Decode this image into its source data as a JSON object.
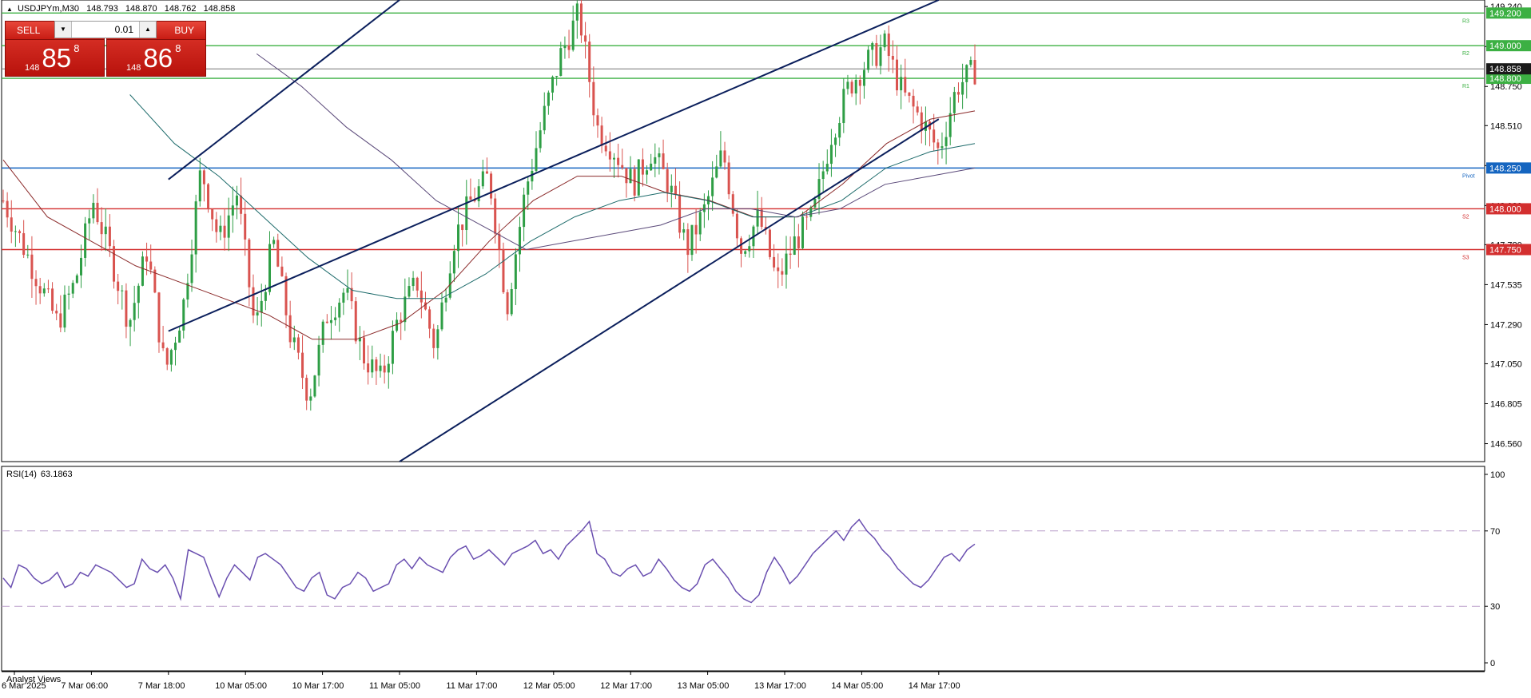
{
  "header": {
    "symbol": "USDJPYm,M30",
    "open": "148.793",
    "high": "148.870",
    "low": "148.762",
    "close": "148.858"
  },
  "trade_panel": {
    "sell_label": "SELL",
    "buy_label": "BUY",
    "volume": "0.01",
    "sell_price": {
      "big": "148",
      "mid": "85",
      "sup": "8"
    },
    "buy_price": {
      "big": "148",
      "mid": "86",
      "sup": "8"
    },
    "colors": {
      "button": "#cc1f16"
    }
  },
  "rsi_label": {
    "name": "RSI(14)",
    "value": "63.1863"
  },
  "footer_text": "Analyst Views",
  "chart_data": [
    {
      "type": "candlestick",
      "title": "USDJPYm,M30",
      "ylim": [
        146.45,
        149.28
      ],
      "y_ticks": [
        "149.240",
        "148.995",
        "148.750",
        "148.510",
        "148.265",
        "148.020",
        "147.780",
        "147.535",
        "147.290",
        "147.050",
        "146.805",
        "146.560"
      ],
      "x_ticks": [
        "6 Mar 2025",
        "7 Mar 06:00",
        "7 Mar 18:00",
        "10 Mar 05:00",
        "10 Mar 17:00",
        "11 Mar 05:00",
        "11 Mar 17:00",
        "12 Mar 05:00",
        "12 Mar 17:00",
        "13 Mar 05:00",
        "13 Mar 17:00",
        "14 Mar 05:00",
        "14 Mar 17:00"
      ],
      "current_price": "148.858",
      "pivot_levels": [
        {
          "name": "R3",
          "value": "149.200",
          "color": "#3cb043"
        },
        {
          "name": "R2",
          "value": "149.000",
          "color": "#3cb043"
        },
        {
          "name": "R1",
          "value": "148.800",
          "color": "#3cb043"
        },
        {
          "name": "Pivot",
          "value": "148.250",
          "color": "#1565c0"
        },
        {
          "name": "S2",
          "value": "148.000",
          "color": "#d32f2f"
        },
        {
          "name": "S3",
          "value": "147.750",
          "color": "#d32f2f"
        }
      ],
      "series": [
        {
          "name": "USDJPYm",
          "key_closes": [
            148.05,
            147.8,
            147.55,
            147.3,
            147.55,
            148.05,
            147.7,
            147.3,
            147.75,
            147.0,
            147.4,
            148.25,
            147.8,
            148.1,
            147.25,
            147.8,
            147.2,
            146.85,
            147.35,
            147.5,
            147.1,
            146.95,
            147.35,
            147.55,
            147.15,
            147.8,
            148.05,
            148.2,
            147.4,
            148.1,
            148.55,
            148.95,
            149.2,
            148.5,
            148.35,
            148.15,
            148.35,
            148.15,
            147.75,
            148.0,
            148.35,
            147.75,
            147.95,
            147.55,
            147.8,
            147.95,
            148.45,
            148.75,
            148.9,
            149.0,
            148.7,
            148.55,
            148.35,
            148.75,
            148.85
          ]
        }
      ],
      "moving_averages": [
        {
          "color": "#8b2a2a",
          "points": [
            148.3,
            147.95,
            147.8,
            147.65,
            147.55,
            147.45,
            147.35,
            147.2,
            147.2,
            147.3,
            147.5,
            147.8,
            148.05,
            148.2,
            148.2,
            148.1,
            148.05,
            147.95,
            147.95,
            148.15,
            148.4,
            148.55,
            148.6
          ]
        },
        {
          "color": "#1d6b6b",
          "points": [
            148.7,
            148.4,
            148.2,
            147.95,
            147.7,
            147.5,
            147.45,
            147.45,
            147.6,
            147.8,
            147.95,
            148.05,
            148.1,
            148.05,
            147.95,
            147.95,
            148.05,
            148.25,
            148.35,
            148.4
          ]
        },
        {
          "color": "#5b4a7a",
          "points": [
            148.95,
            148.75,
            148.5,
            148.3,
            148.05,
            147.9,
            147.75,
            147.8,
            147.85,
            147.9,
            148.0,
            148.0,
            147.95,
            148.0,
            148.15,
            148.2,
            148.25
          ]
        }
      ],
      "channel_lines": [
        {
          "from": [
            148.18,
            "7 Mar 18:00"
          ],
          "to": [
            149.28,
            "11 Mar 05:00"
          ]
        },
        {
          "from": [
            147.25,
            "7 Mar 18:00"
          ],
          "to": [
            149.28,
            "14 Mar 17:00"
          ]
        },
        {
          "from": [
            146.45,
            "11 Mar 05:00"
          ],
          "to": [
            148.55,
            "14 Mar 17:00"
          ]
        }
      ]
    },
    {
      "type": "line",
      "title": "RSI(14) 63.1863",
      "ylim": [
        0,
        100
      ],
      "y_ticks": [
        "100",
        "70",
        "30",
        "0"
      ],
      "levels": [
        70,
        30
      ],
      "series": [
        {
          "name": "RSI(14)",
          "color": "#6a4fb0",
          "values": [
            45,
            40,
            52,
            50,
            45,
            42,
            44,
            48,
            40,
            42,
            48,
            46,
            52,
            50,
            48,
            44,
            40,
            42,
            55,
            50,
            48,
            52,
            45,
            34,
            60,
            58,
            56,
            45,
            35,
            45,
            52,
            48,
            44,
            56,
            58,
            55,
            52,
            46,
            40,
            38,
            45,
            48,
            36,
            34,
            40,
            42,
            48,
            45,
            38,
            40,
            42,
            52,
            55,
            50,
            56,
            52,
            50,
            48,
            56,
            60,
            62,
            55,
            57,
            60,
            56,
            52,
            58,
            60,
            62,
            65,
            58,
            60,
            55,
            62,
            66,
            70,
            75,
            58,
            55,
            48,
            46,
            50,
            52,
            46,
            48,
            55,
            50,
            44,
            40,
            38,
            42,
            52,
            55,
            50,
            45,
            38,
            34,
            32,
            36,
            48,
            56,
            50,
            42,
            46,
            52,
            58,
            62,
            66,
            70,
            65,
            72,
            76,
            70,
            66,
            60,
            56,
            50,
            46,
            42,
            40,
            44,
            50,
            56,
            58,
            54,
            60,
            63
          ]
        }
      ]
    }
  ]
}
